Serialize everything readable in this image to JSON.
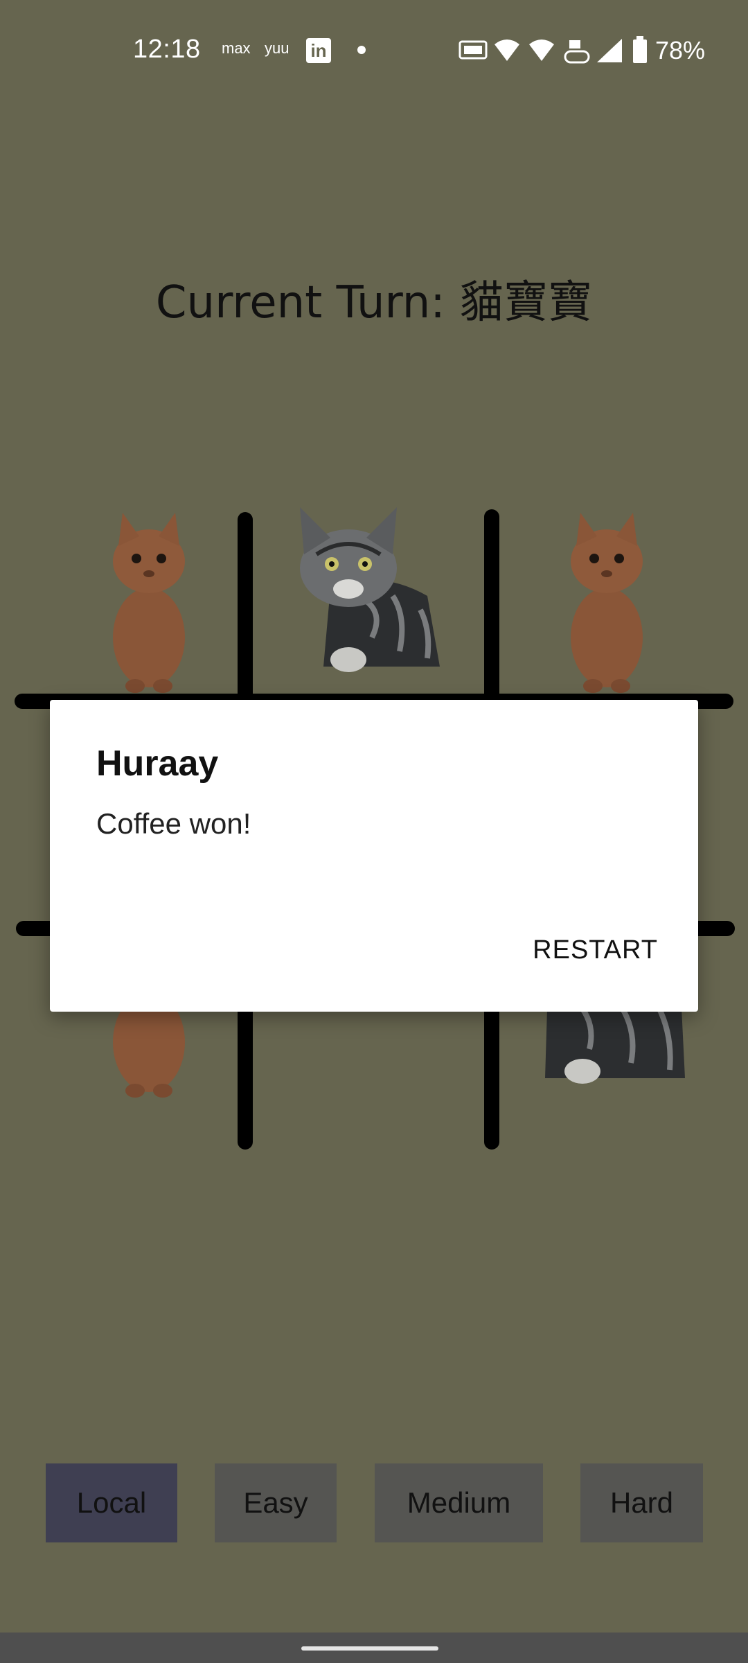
{
  "status_bar": {
    "time": "12:18",
    "icons": [
      "max-icon",
      "yuu-icon",
      "linkedin-icon",
      "dot-icon",
      "auto-hz-icon",
      "wifi-icon",
      "wifi-icon",
      "volte-icon",
      "signal-icon",
      "battery-icon"
    ],
    "left_labels": [
      "max",
      "yuu",
      "in"
    ],
    "battery_percent": "78%"
  },
  "game": {
    "turn_title": "Current Turn: 貓寶寶",
    "board": [
      [
        "orange-cat",
        "tabby-cat",
        "orange-cat"
      ],
      [
        "",
        "",
        ""
      ],
      [
        "orange-cat",
        "",
        "tabby-cat"
      ]
    ]
  },
  "dialog": {
    "title": "Huraay",
    "message": "Coffee won!",
    "button": "RESTART"
  },
  "modes": {
    "local": "Local",
    "easy": "Easy",
    "medium": "Medium",
    "hard": "Hard"
  },
  "colors": {
    "background": "#66654f",
    "button_selected": "#3f3f52",
    "button_default": "#555552",
    "grid": "#000000"
  }
}
